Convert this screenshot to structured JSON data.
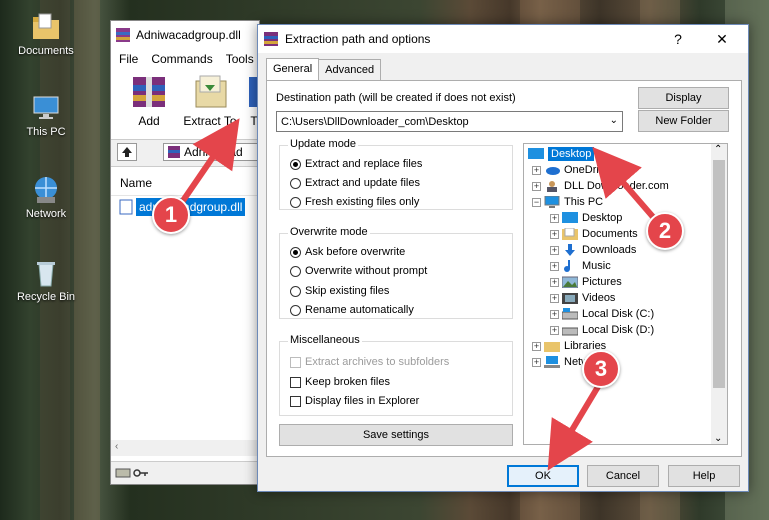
{
  "desktop": {
    "icons": [
      {
        "label": "Documents",
        "icon": "folder-icon"
      },
      {
        "label": "This PC",
        "icon": "monitor-icon"
      },
      {
        "label": "Network",
        "icon": "network-icon"
      },
      {
        "label": "Recycle Bin",
        "icon": "recycle-bin-icon"
      }
    ]
  },
  "winrar": {
    "title": "Adniwacadgroup.dll",
    "menu": [
      "File",
      "Commands",
      "Tools"
    ],
    "toolbar": {
      "add": "Add",
      "extract_to": "Extract To",
      "partial": "T"
    },
    "address": "Adniwacad",
    "column_name": "Name",
    "file_name": "adniwacadgroup.dll"
  },
  "dialog": {
    "title": "Extraction path and options",
    "help": "?",
    "close": "✕",
    "tabs": [
      "General",
      "Advanced"
    ],
    "dest_label": "Destination path (will be created if does not exist)",
    "dest_value": "C:\\Users\\DllDownloader_com\\Desktop",
    "display_button": "Display",
    "new_folder_button": "New Folder",
    "update_mode": {
      "title": "Update mode",
      "options": [
        "Extract and replace files",
        "Extract and update files",
        "Fresh existing files only"
      ],
      "selected": 0
    },
    "overwrite_mode": {
      "title": "Overwrite mode",
      "options": [
        "Ask before overwrite",
        "Overwrite without prompt",
        "Skip existing files",
        "Rename automatically"
      ],
      "selected": 0
    },
    "misc": {
      "title": "Miscellaneous",
      "options": [
        "Extract archives to subfolders",
        "Keep broken files",
        "Display files in Explorer"
      ]
    },
    "save_settings": "Save settings",
    "tree": {
      "root": "Desktop",
      "items": [
        "OneDrive",
        "DLL Downloader.com",
        "This PC",
        "Desktop",
        "Documents",
        "Downloads",
        "Music",
        "Pictures",
        "Videos",
        "Local Disk (C:)",
        "Local Disk (D:)",
        "Libraries",
        "Network"
      ]
    },
    "ok": "OK",
    "cancel": "Cancel",
    "help_button": "Help"
  },
  "annotations": {
    "steps": [
      "1",
      "2",
      "3"
    ],
    "color": "#e4454b"
  }
}
